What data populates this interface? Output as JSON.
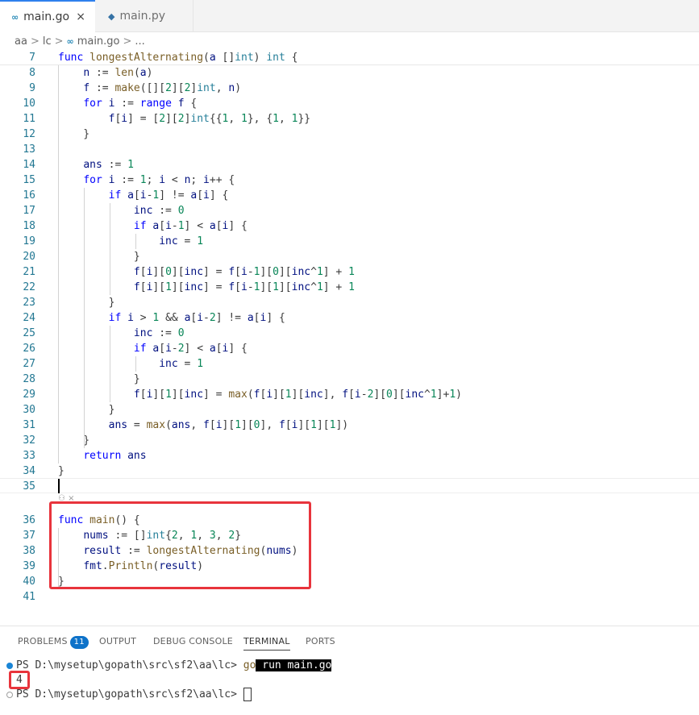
{
  "tabs": [
    {
      "icon": "go-icon",
      "label": "main.go",
      "active": true,
      "close": "×"
    },
    {
      "icon": "python-icon",
      "label": "main.py",
      "active": false
    }
  ],
  "breadcrumb": {
    "parts": [
      "aa",
      "lc",
      "main.go",
      "..."
    ],
    "sep": ">"
  },
  "code_lines": [
    {
      "n": "7",
      "html": "<span class=\"kw\">func</span> <span class=\"fn\">longestAlternating</span>(<span class=\"vr\">a</span> []<span class=\"ty\">int</span>) <span class=\"ty\">int</span> {"
    },
    {
      "n": "8",
      "html": "    <span class=\"vr\">n</span> := <span class=\"fn\">len</span>(<span class=\"vr\">a</span>)"
    },
    {
      "n": "9",
      "html": "    <span class=\"vr\">f</span> := <span class=\"fn\">make</span>([][<span class=\"num\">2</span>][<span class=\"num\">2</span>]<span class=\"ty\">int</span>, <span class=\"vr\">n</span>)"
    },
    {
      "n": "10",
      "html": "    <span class=\"kw\">for</span> <span class=\"vr\">i</span> := <span class=\"kw\">range</span> <span class=\"vr\">f</span> {"
    },
    {
      "n": "11",
      "html": "        <span class=\"vr\">f</span>[<span class=\"vr\">i</span>] = [<span class=\"num\">2</span>][<span class=\"num\">2</span>]<span class=\"ty\">int</span>{{<span class=\"num\">1</span>, <span class=\"num\">1</span>}, {<span class=\"num\">1</span>, <span class=\"num\">1</span>}}"
    },
    {
      "n": "12",
      "html": "    }"
    },
    {
      "n": "13",
      "html": ""
    },
    {
      "n": "14",
      "html": "    <span class=\"vr\">ans</span> := <span class=\"num\">1</span>"
    },
    {
      "n": "15",
      "html": "    <span class=\"kw\">for</span> <span class=\"vr\">i</span> := <span class=\"num\">1</span>; <span class=\"vr\">i</span> &lt; <span class=\"vr\">n</span>; <span class=\"vr\">i</span>++ {"
    },
    {
      "n": "16",
      "html": "        <span class=\"kw\">if</span> <span class=\"vr\">a</span>[<span class=\"vr\">i</span>-<span class=\"num\">1</span>] != <span class=\"vr\">a</span>[<span class=\"vr\">i</span>] {"
    },
    {
      "n": "17",
      "html": "            <span class=\"vr\">inc</span> := <span class=\"num\">0</span>"
    },
    {
      "n": "18",
      "html": "            <span class=\"kw\">if</span> <span class=\"vr\">a</span>[<span class=\"vr\">i</span>-<span class=\"num\">1</span>] &lt; <span class=\"vr\">a</span>[<span class=\"vr\">i</span>] {"
    },
    {
      "n": "19",
      "html": "                <span class=\"vr\">inc</span> = <span class=\"num\">1</span>"
    },
    {
      "n": "20",
      "html": "            }"
    },
    {
      "n": "21",
      "html": "            <span class=\"vr\">f</span>[<span class=\"vr\">i</span>][<span class=\"num\">0</span>][<span class=\"vr\">inc</span>] = <span class=\"vr\">f</span>[<span class=\"vr\">i</span>-<span class=\"num\">1</span>][<span class=\"num\">0</span>][<span class=\"vr\">inc</span>^<span class=\"num\">1</span>] + <span class=\"num\">1</span>"
    },
    {
      "n": "22",
      "html": "            <span class=\"vr\">f</span>[<span class=\"vr\">i</span>][<span class=\"num\">1</span>][<span class=\"vr\">inc</span>] = <span class=\"vr\">f</span>[<span class=\"vr\">i</span>-<span class=\"num\">1</span>][<span class=\"num\">1</span>][<span class=\"vr\">inc</span>^<span class=\"num\">1</span>] + <span class=\"num\">1</span>"
    },
    {
      "n": "23",
      "html": "        }"
    },
    {
      "n": "24",
      "html": "        <span class=\"kw\">if</span> <span class=\"vr\">i</span> &gt; <span class=\"num\">1</span> &amp;&amp; <span class=\"vr\">a</span>[<span class=\"vr\">i</span>-<span class=\"num\">2</span>] != <span class=\"vr\">a</span>[<span class=\"vr\">i</span>] {"
    },
    {
      "n": "25",
      "html": "            <span class=\"vr\">inc</span> := <span class=\"num\">0</span>"
    },
    {
      "n": "26",
      "html": "            <span class=\"kw\">if</span> <span class=\"vr\">a</span>[<span class=\"vr\">i</span>-<span class=\"num\">2</span>] &lt; <span class=\"vr\">a</span>[<span class=\"vr\">i</span>] {"
    },
    {
      "n": "27",
      "html": "                <span class=\"vr\">inc</span> = <span class=\"num\">1</span>"
    },
    {
      "n": "28",
      "html": "            }"
    },
    {
      "n": "29",
      "html": "            <span class=\"vr\">f</span>[<span class=\"vr\">i</span>][<span class=\"num\">1</span>][<span class=\"vr\">inc</span>] = <span class=\"fn\">max</span>(<span class=\"vr\">f</span>[<span class=\"vr\">i</span>][<span class=\"num\">1</span>][<span class=\"vr\">inc</span>], <span class=\"vr\">f</span>[<span class=\"vr\">i</span>-<span class=\"num\">2</span>][<span class=\"num\">0</span>][<span class=\"vr\">inc</span>^<span class=\"num\">1</span>]+<span class=\"num\">1</span>)"
    },
    {
      "n": "30",
      "html": "        }"
    },
    {
      "n": "31",
      "html": "        <span class=\"vr\">ans</span> = <span class=\"fn\">max</span>(<span class=\"vr\">ans</span>, <span class=\"vr\">f</span>[<span class=\"vr\">i</span>][<span class=\"num\">1</span>][<span class=\"num\">0</span>], <span class=\"vr\">f</span>[<span class=\"vr\">i</span>][<span class=\"num\">1</span>][<span class=\"num\">1</span>])"
    },
    {
      "n": "32",
      "html": "    }"
    },
    {
      "n": "33",
      "html": "    <span class=\"kw\">return</span> <span class=\"vr\">ans</span>"
    },
    {
      "n": "34",
      "html": "}"
    },
    {
      "n": "35",
      "html": ""
    },
    {
      "n": "36",
      "html": "<span class=\"kw\">func</span> <span class=\"fn\">main</span>() {"
    },
    {
      "n": "37",
      "html": "    <span class=\"vr\">nums</span> := []<span class=\"ty\">int</span>{<span class=\"num\">2</span>, <span class=\"num\">1</span>, <span class=\"num\">3</span>, <span class=\"num\">2</span>}"
    },
    {
      "n": "38",
      "html": "    <span class=\"vr\">result</span> := <span class=\"fn\">longestAlternating</span>(<span class=\"vr\">nums</span>)"
    },
    {
      "n": "39",
      "html": "    <span class=\"vr\">fmt</span>.<span class=\"fn\">Println</span>(<span class=\"vr\">result</span>)"
    },
    {
      "n": "40",
      "html": "}"
    },
    {
      "n": "41",
      "html": ""
    }
  ],
  "codelens": "⚇ ×",
  "panel": {
    "tabs": [
      {
        "label": "PROBLEMS",
        "badge": "11"
      },
      {
        "label": "OUTPUT"
      },
      {
        "label": "DEBUG CONSOLE"
      },
      {
        "label": "TERMINAL",
        "active": true
      },
      {
        "label": "PORTS"
      }
    ],
    "terminal": {
      "prompt1": "PS D:\\mysetup\\gopath\\src\\sf2\\aa\\lc> ",
      "cmd_go": "go",
      "cmd_rest": " run main.go",
      "output": "4",
      "prompt2": "PS D:\\mysetup\\gopath\\src\\sf2\\aa\\lc> "
    }
  }
}
